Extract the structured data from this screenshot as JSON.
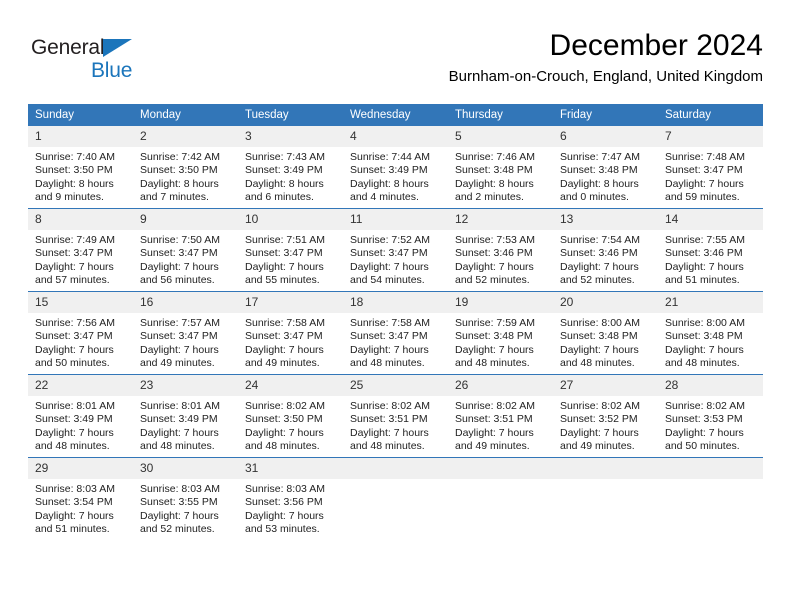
{
  "brand": {
    "name_part1": "General",
    "name_part2": "Blue",
    "triangle_color": "#1b75bb"
  },
  "header": {
    "title": "December 2024",
    "subtitle": "Burnham-on-Crouch, England, United Kingdom"
  },
  "colors": {
    "header_blue": "#3276b8",
    "daynum_bg": "#f0f0f0",
    "brand_blue": "#1b75bb"
  },
  "weekdays": [
    "Sunday",
    "Monday",
    "Tuesday",
    "Wednesday",
    "Thursday",
    "Friday",
    "Saturday"
  ],
  "weeks": [
    [
      {
        "day": "1",
        "sunrise": "Sunrise: 7:40 AM",
        "sunset": "Sunset: 3:50 PM",
        "daylight1": "Daylight: 8 hours",
        "daylight2": "and 9 minutes."
      },
      {
        "day": "2",
        "sunrise": "Sunrise: 7:42 AM",
        "sunset": "Sunset: 3:50 PM",
        "daylight1": "Daylight: 8 hours",
        "daylight2": "and 7 minutes."
      },
      {
        "day": "3",
        "sunrise": "Sunrise: 7:43 AM",
        "sunset": "Sunset: 3:49 PM",
        "daylight1": "Daylight: 8 hours",
        "daylight2": "and 6 minutes."
      },
      {
        "day": "4",
        "sunrise": "Sunrise: 7:44 AM",
        "sunset": "Sunset: 3:49 PM",
        "daylight1": "Daylight: 8 hours",
        "daylight2": "and 4 minutes."
      },
      {
        "day": "5",
        "sunrise": "Sunrise: 7:46 AM",
        "sunset": "Sunset: 3:48 PM",
        "daylight1": "Daylight: 8 hours",
        "daylight2": "and 2 minutes."
      },
      {
        "day": "6",
        "sunrise": "Sunrise: 7:47 AM",
        "sunset": "Sunset: 3:48 PM",
        "daylight1": "Daylight: 8 hours",
        "daylight2": "and 0 minutes."
      },
      {
        "day": "7",
        "sunrise": "Sunrise: 7:48 AM",
        "sunset": "Sunset: 3:47 PM",
        "daylight1": "Daylight: 7 hours",
        "daylight2": "and 59 minutes."
      }
    ],
    [
      {
        "day": "8",
        "sunrise": "Sunrise: 7:49 AM",
        "sunset": "Sunset: 3:47 PM",
        "daylight1": "Daylight: 7 hours",
        "daylight2": "and 57 minutes."
      },
      {
        "day": "9",
        "sunrise": "Sunrise: 7:50 AM",
        "sunset": "Sunset: 3:47 PM",
        "daylight1": "Daylight: 7 hours",
        "daylight2": "and 56 minutes."
      },
      {
        "day": "10",
        "sunrise": "Sunrise: 7:51 AM",
        "sunset": "Sunset: 3:47 PM",
        "daylight1": "Daylight: 7 hours",
        "daylight2": "and 55 minutes."
      },
      {
        "day": "11",
        "sunrise": "Sunrise: 7:52 AM",
        "sunset": "Sunset: 3:47 PM",
        "daylight1": "Daylight: 7 hours",
        "daylight2": "and 54 minutes."
      },
      {
        "day": "12",
        "sunrise": "Sunrise: 7:53 AM",
        "sunset": "Sunset: 3:46 PM",
        "daylight1": "Daylight: 7 hours",
        "daylight2": "and 52 minutes."
      },
      {
        "day": "13",
        "sunrise": "Sunrise: 7:54 AM",
        "sunset": "Sunset: 3:46 PM",
        "daylight1": "Daylight: 7 hours",
        "daylight2": "and 52 minutes."
      },
      {
        "day": "14",
        "sunrise": "Sunrise: 7:55 AM",
        "sunset": "Sunset: 3:46 PM",
        "daylight1": "Daylight: 7 hours",
        "daylight2": "and 51 minutes."
      }
    ],
    [
      {
        "day": "15",
        "sunrise": "Sunrise: 7:56 AM",
        "sunset": "Sunset: 3:47 PM",
        "daylight1": "Daylight: 7 hours",
        "daylight2": "and 50 minutes."
      },
      {
        "day": "16",
        "sunrise": "Sunrise: 7:57 AM",
        "sunset": "Sunset: 3:47 PM",
        "daylight1": "Daylight: 7 hours",
        "daylight2": "and 49 minutes."
      },
      {
        "day": "17",
        "sunrise": "Sunrise: 7:58 AM",
        "sunset": "Sunset: 3:47 PM",
        "daylight1": "Daylight: 7 hours",
        "daylight2": "and 49 minutes."
      },
      {
        "day": "18",
        "sunrise": "Sunrise: 7:58 AM",
        "sunset": "Sunset: 3:47 PM",
        "daylight1": "Daylight: 7 hours",
        "daylight2": "and 48 minutes."
      },
      {
        "day": "19",
        "sunrise": "Sunrise: 7:59 AM",
        "sunset": "Sunset: 3:48 PM",
        "daylight1": "Daylight: 7 hours",
        "daylight2": "and 48 minutes."
      },
      {
        "day": "20",
        "sunrise": "Sunrise: 8:00 AM",
        "sunset": "Sunset: 3:48 PM",
        "daylight1": "Daylight: 7 hours",
        "daylight2": "and 48 minutes."
      },
      {
        "day": "21",
        "sunrise": "Sunrise: 8:00 AM",
        "sunset": "Sunset: 3:48 PM",
        "daylight1": "Daylight: 7 hours",
        "daylight2": "and 48 minutes."
      }
    ],
    [
      {
        "day": "22",
        "sunrise": "Sunrise: 8:01 AM",
        "sunset": "Sunset: 3:49 PM",
        "daylight1": "Daylight: 7 hours",
        "daylight2": "and 48 minutes."
      },
      {
        "day": "23",
        "sunrise": "Sunrise: 8:01 AM",
        "sunset": "Sunset: 3:49 PM",
        "daylight1": "Daylight: 7 hours",
        "daylight2": "and 48 minutes."
      },
      {
        "day": "24",
        "sunrise": "Sunrise: 8:02 AM",
        "sunset": "Sunset: 3:50 PM",
        "daylight1": "Daylight: 7 hours",
        "daylight2": "and 48 minutes."
      },
      {
        "day": "25",
        "sunrise": "Sunrise: 8:02 AM",
        "sunset": "Sunset: 3:51 PM",
        "daylight1": "Daylight: 7 hours",
        "daylight2": "and 48 minutes."
      },
      {
        "day": "26",
        "sunrise": "Sunrise: 8:02 AM",
        "sunset": "Sunset: 3:51 PM",
        "daylight1": "Daylight: 7 hours",
        "daylight2": "and 49 minutes."
      },
      {
        "day": "27",
        "sunrise": "Sunrise: 8:02 AM",
        "sunset": "Sunset: 3:52 PM",
        "daylight1": "Daylight: 7 hours",
        "daylight2": "and 49 minutes."
      },
      {
        "day": "28",
        "sunrise": "Sunrise: 8:02 AM",
        "sunset": "Sunset: 3:53 PM",
        "daylight1": "Daylight: 7 hours",
        "daylight2": "and 50 minutes."
      }
    ],
    [
      {
        "day": "29",
        "sunrise": "Sunrise: 8:03 AM",
        "sunset": "Sunset: 3:54 PM",
        "daylight1": "Daylight: 7 hours",
        "daylight2": "and 51 minutes."
      },
      {
        "day": "30",
        "sunrise": "Sunrise: 8:03 AM",
        "sunset": "Sunset: 3:55 PM",
        "daylight1": "Daylight: 7 hours",
        "daylight2": "and 52 minutes."
      },
      {
        "day": "31",
        "sunrise": "Sunrise: 8:03 AM",
        "sunset": "Sunset: 3:56 PM",
        "daylight1": "Daylight: 7 hours",
        "daylight2": "and 53 minutes."
      },
      {
        "day": "",
        "sunrise": "",
        "sunset": "",
        "daylight1": "",
        "daylight2": ""
      },
      {
        "day": "",
        "sunrise": "",
        "sunset": "",
        "daylight1": "",
        "daylight2": ""
      },
      {
        "day": "",
        "sunrise": "",
        "sunset": "",
        "daylight1": "",
        "daylight2": ""
      },
      {
        "day": "",
        "sunrise": "",
        "sunset": "",
        "daylight1": "",
        "daylight2": ""
      }
    ]
  ]
}
